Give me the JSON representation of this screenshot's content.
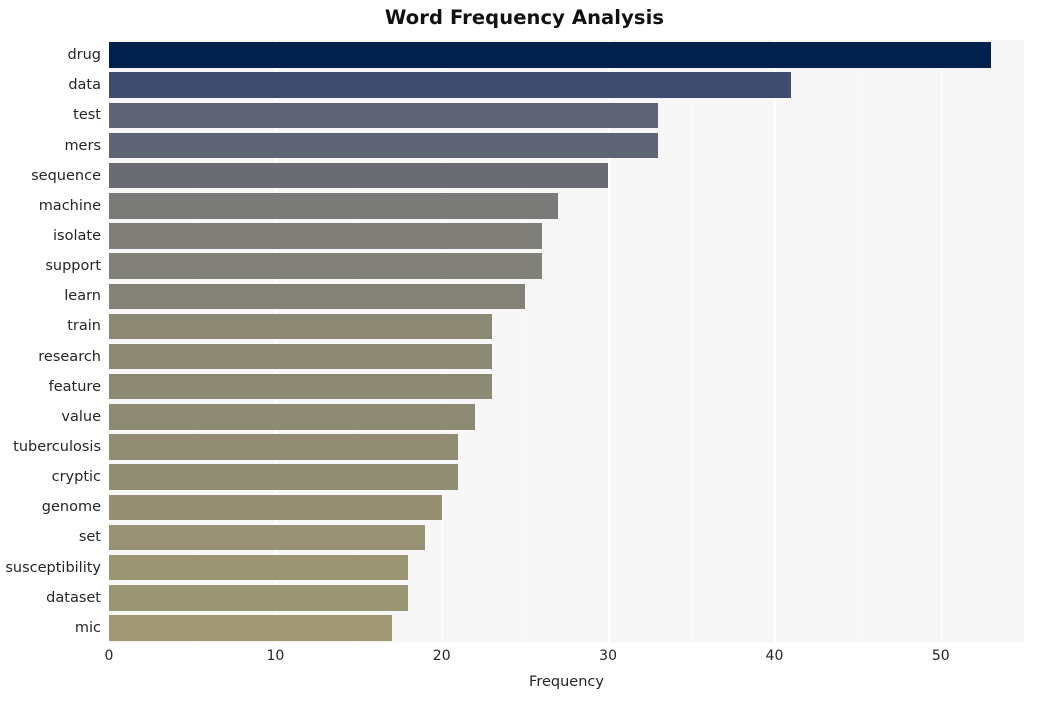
{
  "chart_data": {
    "type": "bar",
    "orientation": "horizontal",
    "title": "Word Frequency Analysis",
    "xlabel": "Frequency",
    "ylabel": "",
    "categories": [
      "drug",
      "data",
      "test",
      "mers",
      "sequence",
      "machine",
      "isolate",
      "support",
      "learn",
      "train",
      "research",
      "feature",
      "value",
      "tuberculosis",
      "cryptic",
      "genome",
      "set",
      "susceptibility",
      "dataset",
      "mic"
    ],
    "values": [
      53,
      41,
      33,
      33,
      30,
      27,
      26,
      26,
      25,
      23,
      23,
      23,
      22,
      21,
      21,
      20,
      19,
      18,
      18,
      17
    ],
    "bar_colors": [
      "#02204c",
      "#3f4c6f",
      "#5e6373",
      "#5f6474",
      "#6b6c72",
      "#7a7a79",
      "#7f7e78",
      "#828179",
      "#848277",
      "#8b8874",
      "#8b8874",
      "#8c8974",
      "#8e8b74",
      "#918d74",
      "#928e74",
      "#959073",
      "#979273",
      "#9a9573",
      "#9a9573",
      "#a09873"
    ],
    "xlim": [
      0,
      55
    ],
    "ylim_categories": 20,
    "xticks": [
      0,
      10,
      20,
      30,
      40,
      50
    ],
    "xtick_labels": [
      "0",
      "10",
      "20",
      "30",
      "40",
      "50"
    ],
    "grid": true,
    "grid_axis": "x",
    "grid_color": "#ffffff",
    "plot_background": "#f7f7f7",
    "figure_background": "#ffffff",
    "legend": null,
    "legend_position": "none",
    "title_color": "#111111",
    "tick_label_color": "#262626"
  }
}
